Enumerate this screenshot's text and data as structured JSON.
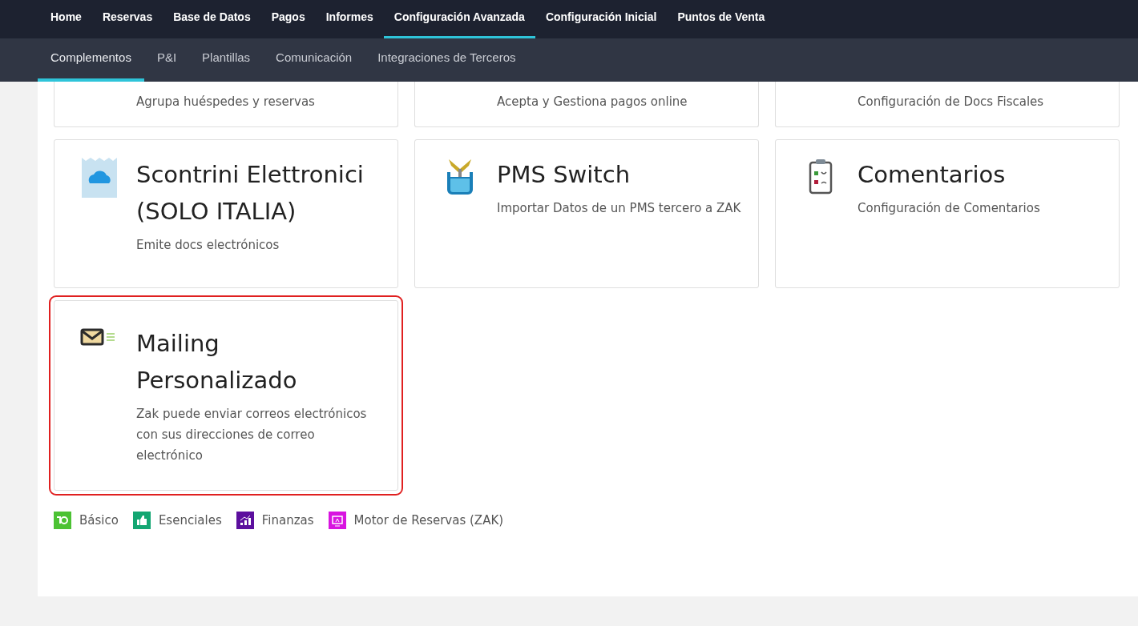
{
  "main_nav": [
    {
      "label": "Home",
      "selected": false
    },
    {
      "label": "Reservas",
      "selected": false
    },
    {
      "label": "Base de Datos",
      "selected": false
    },
    {
      "label": "Pagos",
      "selected": false
    },
    {
      "label": "Informes",
      "selected": false
    },
    {
      "label": "Configuración Avanzada",
      "selected": true
    },
    {
      "label": "Configuración Inicial",
      "selected": false
    },
    {
      "label": "Puntos de Venta",
      "selected": false
    }
  ],
  "sub_nav": [
    {
      "label": "Complementos",
      "selected": true
    },
    {
      "label": "P&I",
      "selected": false
    },
    {
      "label": "Plantillas",
      "selected": false
    },
    {
      "label": "Comunicación",
      "selected": false
    },
    {
      "label": "Integraciones de Terceros",
      "selected": false
    }
  ],
  "cards": [
    {
      "kind": "cut",
      "description": "Agrupa huéspedes y reservas",
      "highlighted": false
    },
    {
      "kind": "cut",
      "description": "Acepta y Gestiona pagos online",
      "highlighted": false
    },
    {
      "kind": "cut",
      "description": "Configuración de Docs Fiscales",
      "highlighted": false
    },
    {
      "kind": "receipt",
      "title": "Scontrini Elettronici (SOLO ITALIA)",
      "description": "Emite docs electrónicos",
      "highlighted": false
    },
    {
      "kind": "switch",
      "title": "PMS Switch",
      "description": "Importar Datos de un PMS tercero a ZAK",
      "highlighted": false
    },
    {
      "kind": "feedback",
      "title": "Comentarios",
      "description": "Configuración de Comentarios",
      "highlighted": false
    },
    {
      "kind": "mail",
      "title": "Mailing Personalizado",
      "description": "Zak puede enviar correos electrónicos con sus direcciones de correo electrónico",
      "highlighted": true
    }
  ],
  "legend": [
    {
      "kind": "basic",
      "label": "Básico",
      "color": "#4cc234"
    },
    {
      "kind": "essential",
      "label": "Esenciales",
      "color": "#13a672"
    },
    {
      "kind": "finance",
      "label": "Finanzas",
      "color": "#5c0f9e"
    },
    {
      "kind": "engine",
      "label": "Motor de Reservas (ZAK)",
      "color": "#d814e0"
    }
  ]
}
